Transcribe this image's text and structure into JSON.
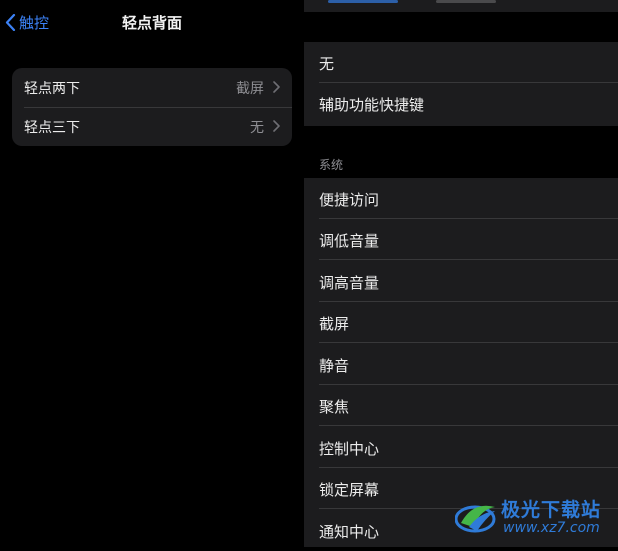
{
  "left": {
    "back_label": "触控",
    "title": "轻点背面",
    "rows": [
      {
        "label": "轻点两下",
        "value": "截屏"
      },
      {
        "label": "轻点三下",
        "value": "无"
      }
    ]
  },
  "right": {
    "top_items": [
      "无",
      "辅助功能快捷键"
    ],
    "section_header": "系统",
    "system_items": [
      "便捷访问",
      "调低音量",
      "调高音量",
      "截屏",
      "静音",
      "聚焦",
      "控制中心",
      "锁定屏幕",
      "通知中心"
    ]
  },
  "watermark": {
    "name": "极光下载站",
    "url": "www.xz7.com"
  },
  "colors": {
    "accent": "#3c82f6",
    "background": "#000000",
    "cell": "#1c1c1e",
    "secondary_text": "#8e8e93"
  }
}
